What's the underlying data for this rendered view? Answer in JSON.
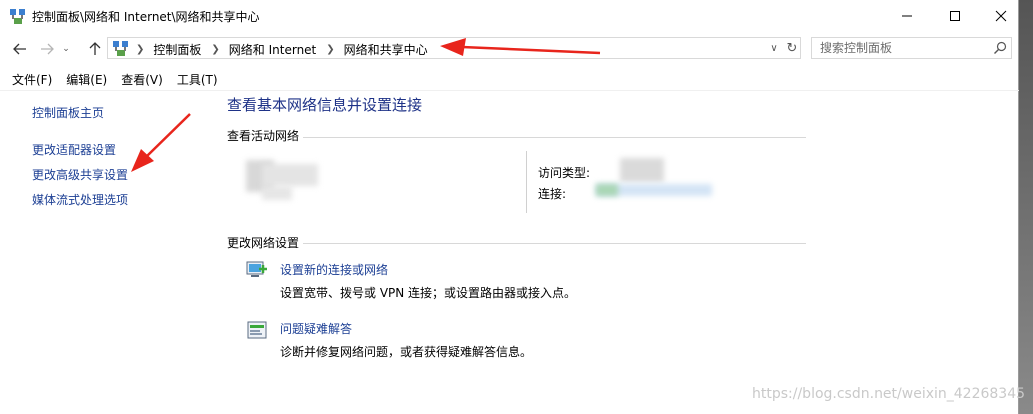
{
  "window": {
    "title": "控制面板\\网络和 Internet\\网络和共享中心",
    "icon": "network-control-panel-icon",
    "caption_buttons": [
      "minimize-icon",
      "maximize-icon",
      "close-icon"
    ]
  },
  "address": {
    "crumbs": [
      "控制面板",
      "网络和 Internet",
      "网络和共享中心"
    ]
  },
  "search": {
    "placeholder": "搜索控制面板"
  },
  "menu": {
    "items": [
      "文件(F)",
      "编辑(E)",
      "查看(V)",
      "工具(T)"
    ]
  },
  "sidebar": {
    "home": "控制面板主页",
    "links": [
      "更改适配器设置",
      "更改高级共享设置",
      "媒体流式处理选项"
    ]
  },
  "main": {
    "title": "查看基本网络信息并设置连接",
    "active_section": "查看活动网络",
    "access_type_label": "访问类型:",
    "connections_label": "连接:",
    "change_section": "更改网络设置",
    "tasks": [
      {
        "link": "设置新的连接或网络",
        "desc": "设置宽带、拨号或 VPN 连接；或设置路由器或接入点。",
        "icon": "new-connection-icon"
      },
      {
        "link": "问题疑难解答",
        "desc": "诊断并修复网络问题，或者获得疑难解答信息。",
        "icon": "troubleshoot-icon"
      }
    ]
  },
  "watermark": "https://blog.csdn.net/weixin_42268345",
  "colors": {
    "link": "#1c3f94",
    "title": "#1e3287",
    "arrow": "#e8251c"
  }
}
